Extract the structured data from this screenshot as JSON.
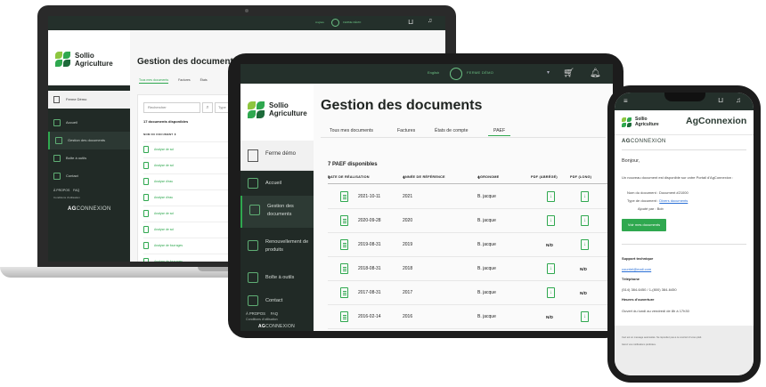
{
  "colors": {
    "brand_green": "#2fa84f",
    "dark_sidebar": "#212a26",
    "topbar": "#24302b",
    "text_dark": "#1f2421"
  },
  "brand": {
    "name_line1": "Sollio",
    "name_line2": "Agriculture",
    "footer_brand_bold": "AG",
    "footer_brand_light": "CONNEXION"
  },
  "laptop": {
    "topbar_lang": "Anglais",
    "topbar_user": "FERME DÉMO",
    "farm_label": "Ferme Démo",
    "nav": [
      "Accueil",
      "Gestion des documents",
      "Boîte à outils",
      "Contact"
    ],
    "footer_links": "À PROPOS    FAQ",
    "footer_conditions": "Conditions d'utilisation",
    "page_title": "Gestion des documents",
    "tabs": [
      "Tous mes documents",
      "Factures",
      "États"
    ],
    "search_placeholder": "Rechercher",
    "type_placeholder": "Type",
    "doc_count": "17 documents disponibles",
    "col_header": "NOM DU DOCUMENT",
    "rows": [
      "Analyse de sol",
      "Analyse de sol",
      "Analyse d'eau",
      "Analyse d'eau",
      "Analyse de sol",
      "Analyse de sol",
      "Analyse de fourrages",
      "Analyse de fourrages"
    ]
  },
  "tablet": {
    "lang": "English",
    "user": "FERME DÉMO",
    "farm_label": "Ferme démo",
    "nav": [
      {
        "label": "Accueil",
        "label2": ""
      },
      {
        "label": "Gestion des",
        "label2": "documents"
      },
      {
        "label": "Renouvellement de",
        "label2": "produits"
      },
      {
        "label": "Boîte à outils",
        "label2": ""
      },
      {
        "label": "Contact",
        "label2": ""
      }
    ],
    "footer_links": "À PROPOS     FAQ",
    "footer_conditions": "Conditions d'utilisation",
    "footer_brand": "AGCONNEXION",
    "page_title": "Gestion des documents",
    "tabs": [
      "Tous mes documents",
      "Factures",
      "États de compte",
      "PAEF"
    ],
    "active_tab": "PAEF",
    "count": "7 PAEF disponibles",
    "columns": [
      "DATE DE RÉALISATION",
      "ANNÉE DE RÉFÉRENCE",
      "AGRONOME",
      "PDF (ABRÉGÉ)",
      "PDF (LONG)"
    ],
    "sort_glyph": "⇕",
    "rows": [
      {
        "date": "2021-10-11",
        "year": "2021",
        "agronome": "B. jacque",
        "abrege": "pdf",
        "long": "pdf"
      },
      {
        "date": "2020-09-28",
        "year": "2020",
        "agronome": "B. jacque",
        "abrege": "pdf",
        "long": "pdf"
      },
      {
        "date": "2019-08-31",
        "year": "2019",
        "agronome": "B. jacque",
        "abrege": "N/D",
        "long": "pdf"
      },
      {
        "date": "2018-08-31",
        "year": "2018",
        "agronome": "B. jacque",
        "abrege": "pdf",
        "long": "N/D"
      },
      {
        "date": "2017-08-31",
        "year": "2017",
        "agronome": "B. jacque",
        "abrege": "pdf",
        "long": "N/D"
      },
      {
        "date": "2016-02-14",
        "year": "2016",
        "agronome": "B. jacque",
        "abrege": "N/D",
        "long": "pdf"
      }
    ]
  },
  "phone": {
    "brand": "AgConnexion",
    "mail_brand_bold": "AG",
    "mail_brand_light": "CONNEXION",
    "greeting": "Bonjour,",
    "intro": "Un nouveau document est disponible sur votre Portail d'AgConnexion :",
    "doc_name_label": "Nom du document :",
    "doc_name_value": "Document #21000",
    "doc_type_label": "Type de document :",
    "doc_type_value": "Divers documents",
    "added_by_label": "Ajouté par :",
    "added_by_value": "Bob",
    "button": "Voir mes documents",
    "support_title": "Support technique",
    "support_email": "courriel@mail.com",
    "phone_title": "Téléphone",
    "phone_value": "(514) 384-6450 / 1-(800) 384-6450",
    "hours_title": "Heures d'ouverture",
    "hours_value": "Ouvert du lundi au vendredi de 8h à 17h30",
    "footer_line1": "Ceci est un message automatisé. Ne répondez pas à ce courriel s'il vous plaît.",
    "footer_line2": "Gérez vos notifications préférées."
  }
}
